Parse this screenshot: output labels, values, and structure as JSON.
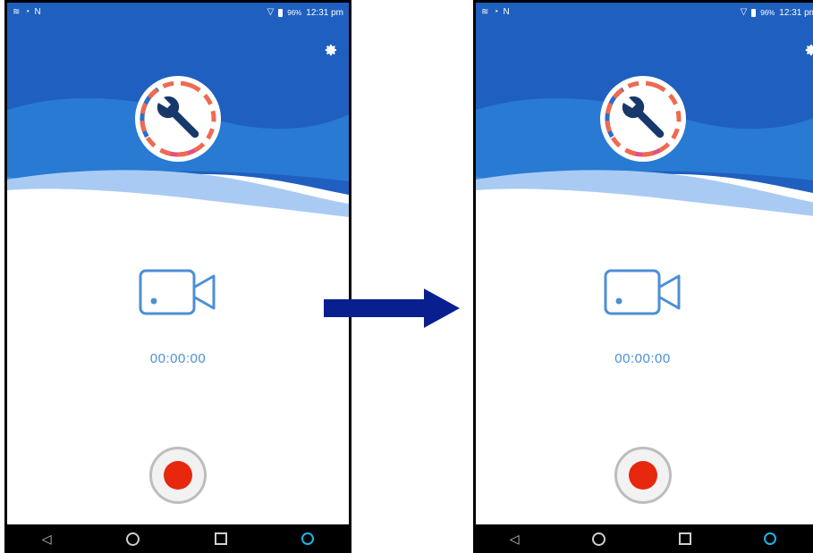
{
  "screens": [
    {
      "status": {
        "battery": "96%",
        "time": "12:31 pm"
      },
      "timer": "00:00:00"
    },
    {
      "status": {
        "battery": "96%",
        "time": "12:31 pm"
      },
      "timer": "00:00:00"
    }
  ],
  "colors": {
    "header_blue": "#1f5fbf",
    "wave_light": "#a9cbf3",
    "accent_blue": "#4c8fd6",
    "record_red": "#e8270f",
    "arrow_navy": "#0a1f8f"
  },
  "icons": {
    "settings": "gear-icon",
    "logo": "wrench-icon",
    "camera": "video-camera-icon",
    "record": "record-icon",
    "nav_back": "back-icon",
    "nav_home": "home-icon",
    "nav_recent": "recents-icon",
    "nav_assist": "assistant-icon",
    "transition": "arrow-right-icon"
  }
}
